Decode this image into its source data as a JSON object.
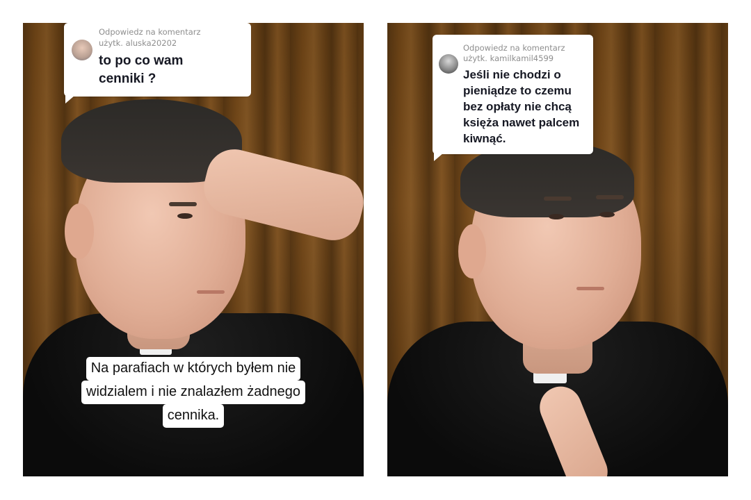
{
  "left_panel": {
    "reply": {
      "header_line1": "Odpowiedz na komentarz",
      "header_line2": "użytk. aluska20202",
      "text_lines": [
        "to po co wam",
        "cenniki ?"
      ]
    },
    "caption_lines": [
      "Na parafiach w których byłem nie",
      "widzialem i nie znalazłem żadnego",
      "cennika."
    ]
  },
  "right_panel": {
    "reply": {
      "header_line1": "Odpowiedz na komentarz",
      "header_line2": "użytk. kamilkamil4599",
      "text_lines": [
        "Jeśli nie chodzi o",
        "pieniądze to czemu",
        "bez opłaty nie chcą",
        "księża nawet palcem",
        "kiwnąć."
      ]
    }
  },
  "colors": {
    "curtain": "#6e4416",
    "bubble_bg": "#ffffff",
    "reply_text": "#161823",
    "meta_text": "#8e8e8e",
    "shirt": "#0f0f0f"
  }
}
